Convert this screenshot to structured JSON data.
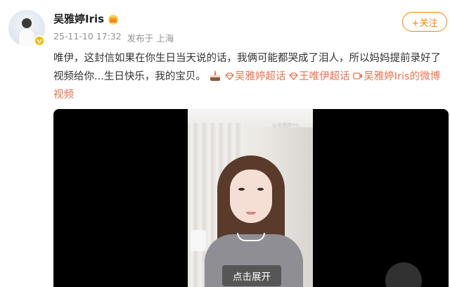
{
  "author": {
    "name": "吴雅婷Iris",
    "badge_icon": "crown-icon",
    "verified_icon": "verified-v-icon",
    "timestamp": "25-11-10 17:32",
    "posted_from": "发布于 上海"
  },
  "follow_button": {
    "label": "+关注"
  },
  "post": {
    "text": "唯伊，这封信如果在你生日当天说的话，我俩可能都哭成了泪人，所以妈妈提前录好了视频给你...生日快乐，我的宝贝。",
    "emoji_icon": "birthday-cake-icon",
    "topic_1": "吴雅婷超话",
    "topic_2": "王唯伊超话",
    "video_link": "吴雅婷Iris的微博视频"
  },
  "video": {
    "expand_label": "点击展开",
    "watermark": "@吴雅婷Iris",
    "play_icon": "play-icon"
  },
  "colors": {
    "accent": "#ff8200",
    "link": "#eb7350",
    "meta_gray": "#939393",
    "video_bg": "#000000"
  }
}
